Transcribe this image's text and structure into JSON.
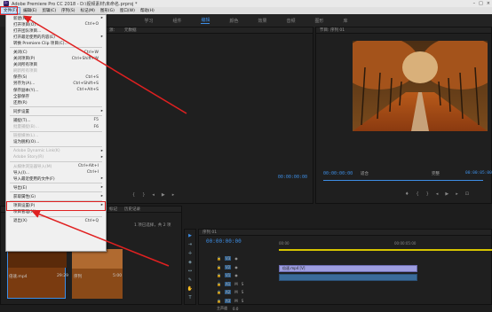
{
  "titlebar": {
    "logo": "Pr",
    "title": "Adobe Premiere Pro CC 2018 - D:\\视频素材\\未命名.prproj *",
    "btn_min": "–",
    "btn_max": "□",
    "btn_close": "×"
  },
  "menubar": [
    "文件(F)",
    "编辑(E)",
    "剪辑(C)",
    "序列(S)",
    "标记(M)",
    "图形(G)",
    "窗口(W)",
    "帮助(H)"
  ],
  "workspace": {
    "tabs": [
      "学习",
      "组件",
      "编辑",
      "颜色",
      "效果",
      "音频",
      "图形",
      "库"
    ],
    "active": "编辑"
  },
  "source_panel": {
    "title": "源：",
    "sub": "元数据",
    "timecode": "00:00:00:00"
  },
  "program_panel": {
    "title": "节目: 序列 01",
    "timecode_left": "00:00:00:00",
    "fit": "适合",
    "full": "完整",
    "timecode_right": "00:00:05:00"
  },
  "file_menu": [
    {
      "label": "新建(N)",
      "arrow": true
    },
    {
      "label": "打开项目(O)...",
      "shortcut": "Ctrl+O"
    },
    {
      "label": "打开团队项目...",
      "disabled": false
    },
    {
      "label": "打开最近使用的内容(E)",
      "arrow": true
    },
    {
      "label": "转换 Premiere Clip 项目(C)..."
    },
    {
      "sep": true
    },
    {
      "label": "关闭(C)",
      "shortcut": "Ctrl+W"
    },
    {
      "label": "关闭项目(P)",
      "shortcut": "Ctrl+Shift+W"
    },
    {
      "label": "关闭所有项目"
    },
    {
      "label": "刷新所有项目",
      "disabled": true
    },
    {
      "label": "保存(S)",
      "shortcut": "Ctrl+S"
    },
    {
      "label": "另存为(A)...",
      "shortcut": "Ctrl+Shift+S"
    },
    {
      "label": "保存副本(Y)...",
      "shortcut": "Ctrl+Alt+S"
    },
    {
      "label": "全部保存"
    },
    {
      "label": "还原(R)"
    },
    {
      "sep": true
    },
    {
      "label": "同步设置",
      "arrow": true
    },
    {
      "sep": true
    },
    {
      "label": "捕捉(T)...",
      "shortcut": "F5"
    },
    {
      "label": "批量捕捉(B)...",
      "shortcut": "F6",
      "disabled": true
    },
    {
      "sep": true
    },
    {
      "label": "链接媒体(L)...",
      "disabled": true
    },
    {
      "label": "设为脱机(O)...",
      "disabled": false
    },
    {
      "sep": true
    },
    {
      "label": "Adobe Dynamic Link(K)",
      "arrow": true,
      "disabled": true
    },
    {
      "label": "Adobe Story(R)",
      "arrow": true,
      "disabled": true
    },
    {
      "sep": true
    },
    {
      "label": "从媒体浏览器导入(M)",
      "shortcut": "Ctrl+Alt+I",
      "disabled": true
    },
    {
      "label": "导入(I)...",
      "shortcut": "Ctrl+I"
    },
    {
      "label": "导入最近使用的文件(F)",
      "arrow": true
    },
    {
      "sep": true
    },
    {
      "label": "导出(E)",
      "arrow": true
    },
    {
      "sep": true
    },
    {
      "label": "获取属性(G)",
      "arrow": true
    },
    {
      "sep": true
    },
    {
      "label": "项目设置(P)",
      "arrow": true
    },
    {
      "label": "项目管理(M)..."
    },
    {
      "sep": true
    },
    {
      "label": "退出(X)",
      "shortcut": "Ctrl+Q"
    }
  ],
  "project_panel": {
    "tab1": "标记",
    "tab2": "历史记录",
    "items_label": "1 项已选择，共 2 项",
    "clip1_name": "倍速.mp4",
    "clip1_dur": "29:29",
    "clip2_name": "序列",
    "clip2_dur": "5:00"
  },
  "timeline": {
    "title": "序列 01",
    "timecode": "00:00:00:00",
    "ruler_start": "00:00",
    "ruler_end": "00:00:05:00",
    "tracks": [
      "V3",
      "V2",
      "V1",
      "A1",
      "A2",
      "A3"
    ],
    "master": "主声道",
    "master_val": "0.0",
    "clip_label": "倍速.mp4 [V]"
  }
}
